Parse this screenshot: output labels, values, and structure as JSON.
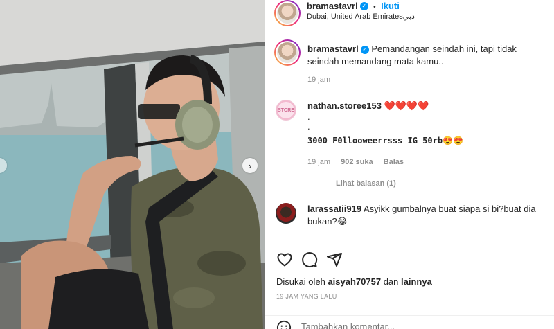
{
  "post": {
    "author": "bramastavrl",
    "follow_label": "Ikuti",
    "location": "Dubai, United Arab Emiratesدبي",
    "caption": "Pemandangan seindah ini, tapi tidak seindah memandang mata kamu..",
    "caption_time": "19 jam",
    "likes_prefix": "Disukai oleh",
    "likes_user": "aisyah70757",
    "likes_and": "dan",
    "likes_others": "lainnya",
    "timestamp": "19 JAM YANG LALU"
  },
  "comments": [
    {
      "user": "nathan.storee153",
      "line1_hearts": "❤️❤️❤️❤️",
      "dot1": ".",
      "dot2": ".",
      "body": "3000 F0llooweerrsss IG 50rb😍😍",
      "time": "19 jam",
      "likes": "902 suka",
      "reply": "Balas",
      "view_replies": "Lihat balasan (1)"
    },
    {
      "user": "larassatii919",
      "body": "Asyikk gumbalnya buat siapa si bi?buat dia bukan?😂"
    }
  ],
  "comment_input": {
    "placeholder": "Tambahkan komentar..."
  },
  "icons": {
    "like": "heart-outline-icon",
    "comment": "speech-bubble-icon",
    "share": "paper-plane-icon",
    "next": "chevron-right-icon",
    "emoji": "smiley-icon"
  },
  "colors": {
    "link_blue": "#0095f6",
    "text": "#262626",
    "muted": "#8e8e8e"
  }
}
